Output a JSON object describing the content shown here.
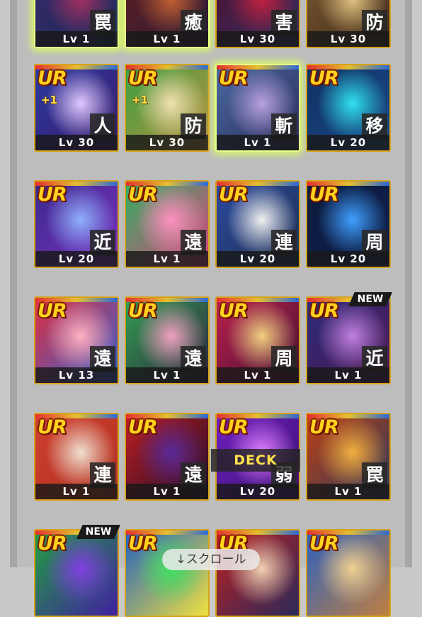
{
  "deck_label": "DECK",
  "scroll_hint": "↓スクロール",
  "new_badge": "NEW",
  "cards": [
    {
      "rarity": "",
      "kanji": "罠",
      "level": "Lv 1",
      "plus": "",
      "glow": true,
      "colors": [
        "#3a2a6a",
        "#a03060",
        "#1a2a5a"
      ]
    },
    {
      "rarity": "",
      "kanji": "癒",
      "level": "Lv 1",
      "plus": "",
      "glow": true,
      "colors": [
        "#602020",
        "#c06030",
        "#2a1a3a"
      ]
    },
    {
      "rarity": "",
      "kanji": "害",
      "level": "Lv 30",
      "plus": "",
      "glow": false,
      "colors": [
        "#501030",
        "#c02040",
        "#303060"
      ]
    },
    {
      "rarity": "",
      "kanji": "防",
      "level": "Lv 30",
      "plus": "",
      "glow": false,
      "colors": [
        "#7a5a30",
        "#e0c080",
        "#402a1a"
      ]
    },
    {
      "rarity": "UR",
      "kanji": "人",
      "level": "Lv 30",
      "plus": "+1",
      "glow": false,
      "colors": [
        "#2a3aa0",
        "#e0c8ff",
        "#3a1a6a"
      ]
    },
    {
      "rarity": "UR",
      "kanji": "防",
      "level": "Lv 30",
      "plus": "+1",
      "glow": false,
      "colors": [
        "#3aa040",
        "#f0e0b0",
        "#c09040"
      ]
    },
    {
      "rarity": "UR",
      "kanji": "斬",
      "level": "Lv 1",
      "plus": "",
      "glow": true,
      "colors": [
        "#4a6aa0",
        "#b8a0e0",
        "#2a2a5a"
      ]
    },
    {
      "rarity": "UR",
      "kanji": "移",
      "level": "Lv 20",
      "plus": "",
      "glow": false,
      "colors": [
        "#103060",
        "#30e0f0",
        "#1a4a8a"
      ]
    },
    {
      "rarity": "UR",
      "kanji": "近",
      "level": "Lv 20",
      "plus": "",
      "glow": false,
      "colors": [
        "#3a2a8a",
        "#90b0ff",
        "#7a30c0"
      ]
    },
    {
      "rarity": "UR",
      "kanji": "遠",
      "level": "Lv 1",
      "plus": "",
      "glow": false,
      "colors": [
        "#30b060",
        "#ff90c0",
        "#e04080"
      ]
    },
    {
      "rarity": "UR",
      "kanji": "連",
      "level": "Lv 20",
      "plus": "",
      "glow": false,
      "colors": [
        "#2a4aa0",
        "#f0f0f0",
        "#203050"
      ]
    },
    {
      "rarity": "UR",
      "kanji": "周",
      "level": "Lv 20",
      "plus": "",
      "glow": false,
      "colors": [
        "#0a1a3a",
        "#40a0ff",
        "#102050"
      ]
    },
    {
      "rarity": "UR",
      "kanji": "遠",
      "level": "Lv 13",
      "plus": "",
      "glow": false,
      "colors": [
        "#e03040",
        "#ffb0c0",
        "#3060d0"
      ]
    },
    {
      "rarity": "UR",
      "kanji": "遠",
      "level": "Lv 1",
      "plus": "",
      "glow": false,
      "colors": [
        "#30a050",
        "#f0a0c0",
        "#302040"
      ]
    },
    {
      "rarity": "UR",
      "kanji": "周",
      "level": "Lv 1",
      "plus": "",
      "glow": false,
      "colors": [
        "#c02050",
        "#f0d080",
        "#401030"
      ]
    },
    {
      "rarity": "UR",
      "kanji": "近",
      "level": "Lv 1",
      "plus": "",
      "glow": false,
      "new": true,
      "colors": [
        "#2a2a7a",
        "#c080e0",
        "#501a50"
      ]
    },
    {
      "rarity": "UR",
      "kanji": "連",
      "level": "Lv 1",
      "plus": "",
      "glow": false,
      "colors": [
        "#d04030",
        "#f0e0d0",
        "#b03020"
      ]
    },
    {
      "rarity": "UR",
      "kanji": "遠",
      "level": "Lv 1",
      "plus": "",
      "glow": false,
      "colors": [
        "#c02020",
        "#5a2a9a",
        "#1a0a2a"
      ]
    },
    {
      "rarity": "UR",
      "kanji": "弱",
      "level": "Lv 20",
      "plus": "",
      "glow": false,
      "colors": [
        "#7020c0",
        "#e080ff",
        "#3a1070"
      ]
    },
    {
      "rarity": "UR",
      "kanji": "罠",
      "level": "Lv 1",
      "plus": "",
      "glow": false,
      "colors": [
        "#c04010",
        "#f0b040",
        "#2a3a60"
      ]
    },
    {
      "rarity": "UR",
      "kanji": "",
      "level": "",
      "plus": "",
      "glow": false,
      "new": true,
      "colors": [
        "#20a040",
        "#8040e0",
        "#4020a0"
      ]
    },
    {
      "rarity": "UR",
      "kanji": "",
      "level": "",
      "plus": "",
      "glow": false,
      "colors": [
        "#2060c0",
        "#40e060",
        "#f0e040"
      ]
    },
    {
      "rarity": "UR",
      "kanji": "",
      "level": "",
      "plus": "",
      "glow": false,
      "colors": [
        "#c02020",
        "#f0d0b0",
        "#2a2a5a"
      ]
    },
    {
      "rarity": "UR",
      "kanji": "",
      "level": "",
      "plus": "",
      "glow": false,
      "colors": [
        "#2a60c0",
        "#f0d090",
        "#c08040"
      ]
    }
  ]
}
